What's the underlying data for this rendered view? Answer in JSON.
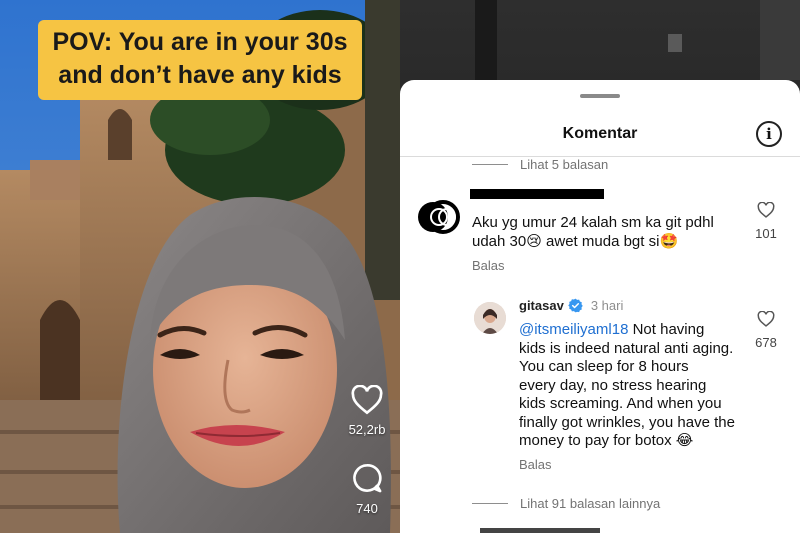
{
  "video": {
    "caption_line1": "POV: You are in your 30s",
    "caption_line2": "and don’t have any kids",
    "actions": {
      "like_count": "52,2rb",
      "comment_count": "740"
    }
  },
  "comments_panel": {
    "title": "Komentar",
    "top_replies_toggle": "Lihat 5 balasan",
    "comment": {
      "text_line1": "Aku yg umur 24 kalah sm ka git pdhl",
      "text_line2_before": "udah 30",
      "emoji_1": "😢",
      "text_line2_after": " awet muda bgt si",
      "emoji_2": "🤩",
      "reply_label": "Balas",
      "like_count": "101"
    },
    "reply": {
      "username": "gitasav",
      "time": "3 hari",
      "mention": "@itsmeiliyaml18",
      "text_first": " Not having",
      "text_lines": [
        "kids is indeed natural anti aging.",
        "You can sleep for 8 hours",
        "every day, no stress hearing",
        "kids screaming. And when you",
        "finally got wrinkles, you have the"
      ],
      "text_last": "money to pay for botox ",
      "emoji": "😂",
      "reply_label": "Balas",
      "like_count": "678"
    },
    "more_replies_toggle": "Lihat 91 balasan lainnya"
  },
  "colors": {
    "caption_bg": "#f6c443",
    "mention": "#1f6fd1",
    "verified": "#3897f0"
  }
}
